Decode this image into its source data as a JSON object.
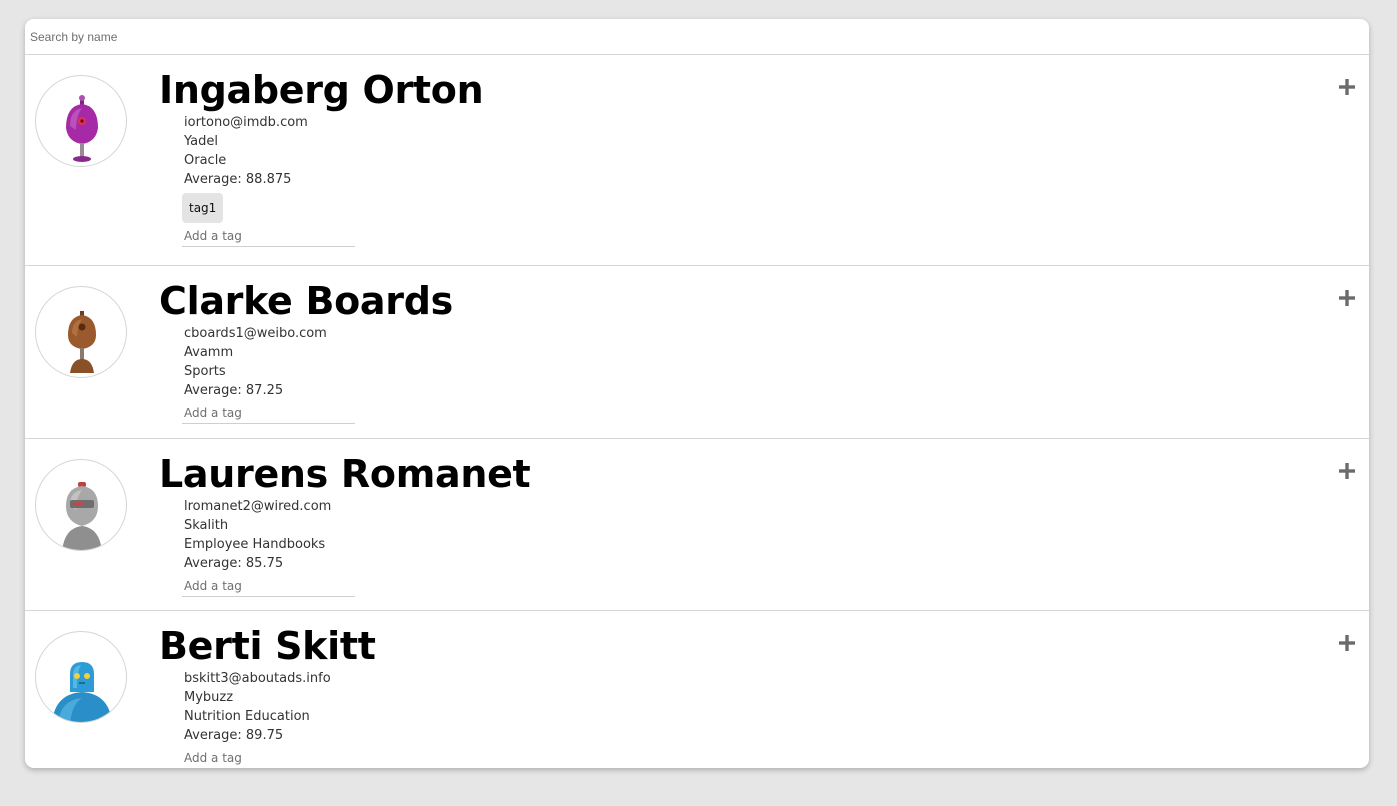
{
  "search": {
    "placeholder": "Search by name"
  },
  "add_tag_placeholder": "Add a tag",
  "colors": {
    "background": "#e6e6e6",
    "card": "#ffffff",
    "tag_bg": "#e4e4e4",
    "divider": "#d6d6d6",
    "expand_icon": "#6b6b6b"
  },
  "students": [
    {
      "name": "Ingaberg Orton",
      "email": "iortono@imdb.com",
      "company": "Yadel",
      "skill": "Oracle",
      "average": "Average: 88.875",
      "tags": [
        "tag1"
      ],
      "avatar_icon": "purple-robot-icon"
    },
    {
      "name": "Clarke Boards",
      "email": "cboards1@weibo.com",
      "company": "Avamm",
      "skill": "Sports",
      "average": "Average: 87.25",
      "tags": [],
      "avatar_icon": "brown-robot-icon"
    },
    {
      "name": "Laurens Romanet",
      "email": "lromanet2@wired.com",
      "company": "Skalith",
      "skill": "Employee Handbooks",
      "average": "Average: 85.75",
      "tags": [],
      "avatar_icon": "gray-robot-icon"
    },
    {
      "name": "Berti Skitt",
      "email": "bskitt3@aboutads.info",
      "company": "Mybuzz",
      "skill": "Nutrition Education",
      "average": "Average: 89.75",
      "tags": [],
      "avatar_icon": "blue-robot-icon"
    }
  ]
}
